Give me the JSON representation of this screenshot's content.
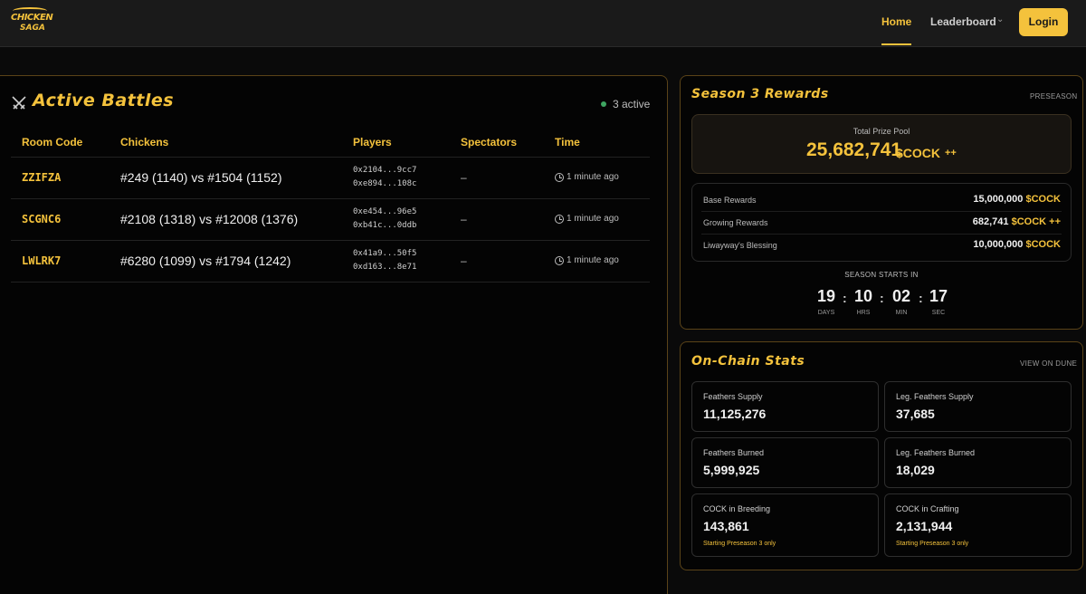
{
  "header": {
    "logo_line1": "CHICKEN",
    "logo_line2": "SAGA",
    "nav_home": "Home",
    "nav_leaderboard": "Leaderboard",
    "nav_chevron": "⌄",
    "login": "Login"
  },
  "battles": {
    "title": "Active Battles",
    "active_count": "3 active",
    "columns": [
      "Room Code",
      "Chickens",
      "Players",
      "Spectators",
      "Time"
    ],
    "rows": [
      {
        "code": "ZZIFZA",
        "chickens": "#249 (1140) vs #1504 (1152)",
        "player1": "0x2104...9cc7",
        "player2": "0xe894...108c",
        "spectators": "–",
        "time": "1 minute ago"
      },
      {
        "code": "SCGNC6",
        "chickens": "#2108 (1318) vs #12008 (1376)",
        "player1": "0xe454...96e5",
        "player2": "0xb41c...0ddb",
        "spectators": "–",
        "time": "1 minute ago"
      },
      {
        "code": "LWLRK7",
        "chickens": "#6280 (1099) vs #1794 (1242)",
        "player1": "0x41a9...50f5",
        "player2": "0xd163...8e71",
        "spectators": "–",
        "time": "1 minute ago"
      }
    ]
  },
  "season": {
    "title": "Season 3 Rewards",
    "badge": "PRESEASON",
    "prize_label": "Total Prize Pool",
    "prize_value": "25,682,741",
    "prize_unit": "$COCK",
    "prize_suffix": "++",
    "rewards": [
      {
        "label": "Base Rewards",
        "value": "15,000,000",
        "unit": "$COCK"
      },
      {
        "label": "Growing Rewards",
        "value": "682,741",
        "unit": "$COCK ++"
      },
      {
        "label": "Liwayway's Blessing",
        "value": "10,000,000",
        "unit": "$COCK"
      }
    ],
    "starts_label": "SEASON STARTS IN",
    "countdown": [
      {
        "num": "19",
        "label": "DAYS"
      },
      {
        "num": "10",
        "label": "HRS"
      },
      {
        "num": "02",
        "label": "MIN"
      },
      {
        "num": "17",
        "label": "SEC"
      }
    ],
    "separator": ":"
  },
  "onchain": {
    "title": "On-Chain Stats",
    "link": "VIEW ON DUNE",
    "stats": [
      {
        "label": "Feathers Supply",
        "value": "11,125,276",
        "note": ""
      },
      {
        "label": "Leg. Feathers Supply",
        "value": "37,685",
        "note": ""
      },
      {
        "label": "Feathers Burned",
        "value": "5,999,925",
        "note": ""
      },
      {
        "label": "Leg. Feathers Burned",
        "value": "18,029",
        "note": ""
      },
      {
        "label": "COCK in Breeding",
        "value": "143,861",
        "note": "Starting Preseason 3 only"
      },
      {
        "label": "COCK in Crafting",
        "value": "2,131,944",
        "note": "Starting Preseason 3 only"
      }
    ]
  }
}
